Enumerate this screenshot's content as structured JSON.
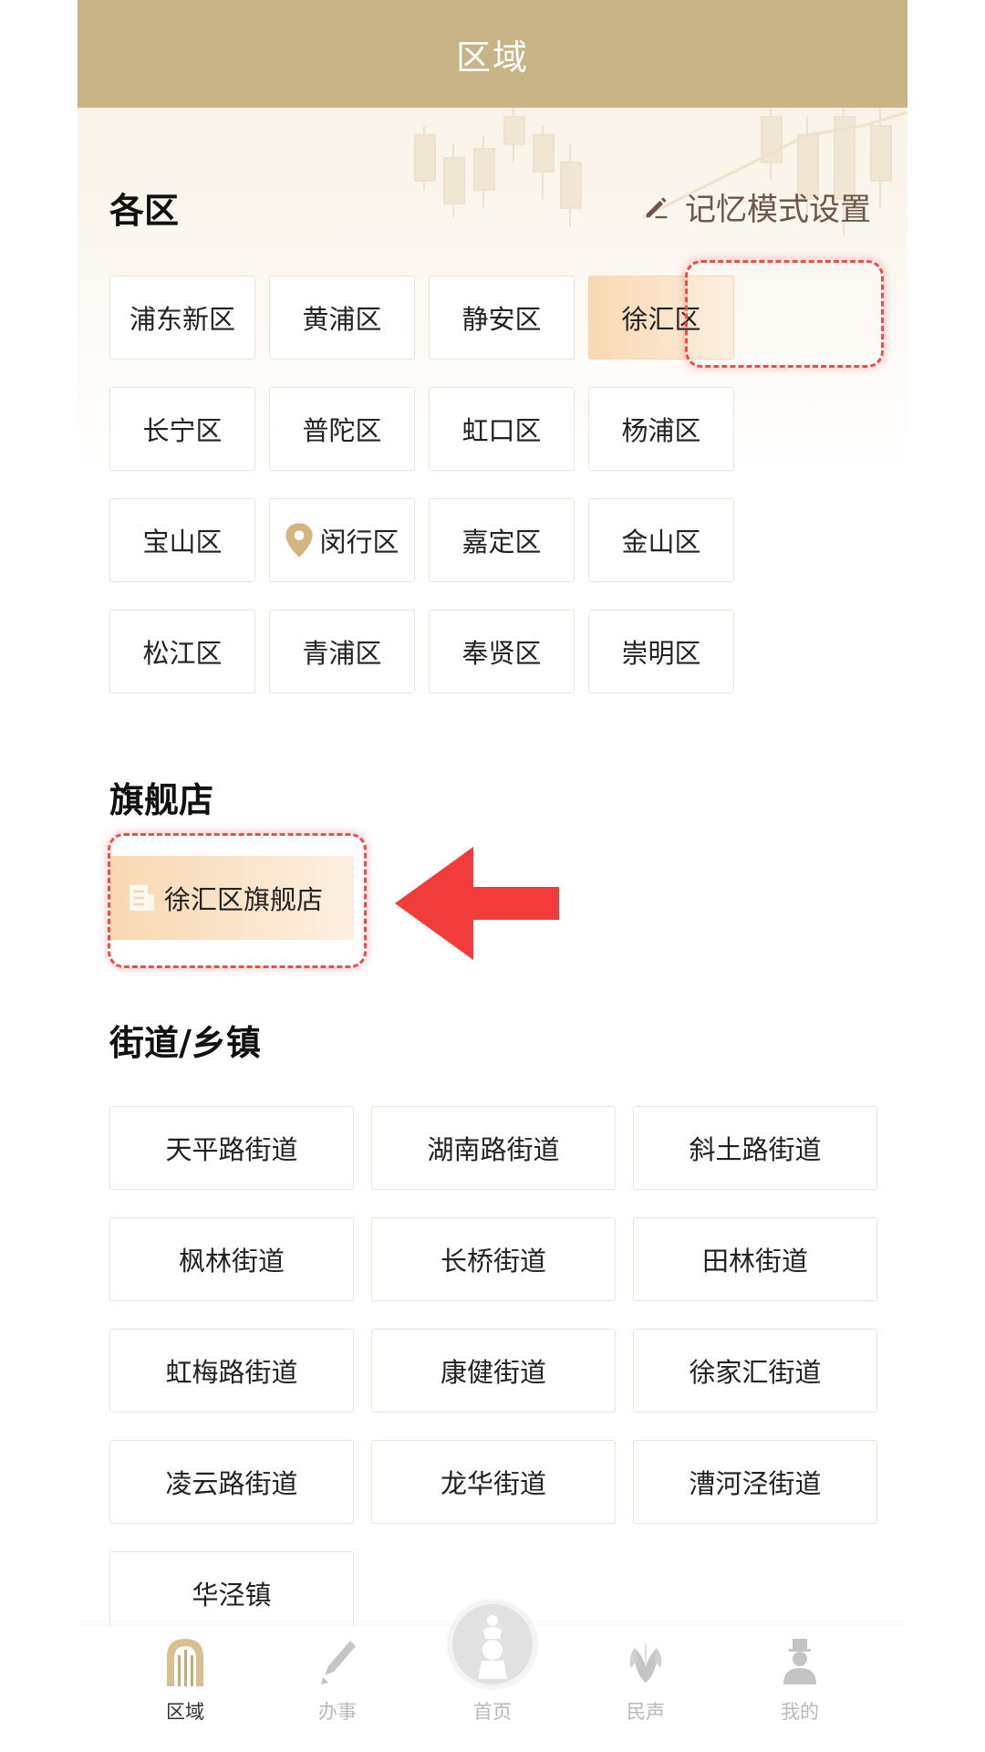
{
  "header": {
    "title": "区域"
  },
  "districts_section": {
    "title": "各区",
    "memory_label": "记忆模式设置"
  },
  "districts": [
    "浦东新区",
    "黄浦区",
    "静安区",
    "徐汇区",
    "长宁区",
    "普陀区",
    "虹口区",
    "杨浦区",
    "宝山区",
    "闵行区",
    "嘉定区",
    "金山区",
    "松江区",
    "青浦区",
    "奉贤区",
    "崇明区"
  ],
  "selected_district": "徐汇区",
  "location_district": "闵行区",
  "flagship_section": {
    "title": "旗舰店",
    "store_label": "徐汇区旗舰店"
  },
  "streets_section": {
    "title": "街道/乡镇"
  },
  "streets": [
    "天平路街道",
    "湖南路街道",
    "斜土路街道",
    "枫林街道",
    "长桥街道",
    "田林街道",
    "虹梅路街道",
    "康健街道",
    "徐家汇街道",
    "凌云路街道",
    "龙华街道",
    "漕河泾街道",
    "华泾镇"
  ],
  "tabbar": {
    "tabs": [
      "区域",
      "办事",
      "首页",
      "民声",
      "我的"
    ],
    "active": "区域"
  },
  "colors": {
    "header": "#c7b386",
    "highlight": "#f04a4a",
    "selected": "#f8d8b2",
    "arrow": "#f23b3b"
  }
}
